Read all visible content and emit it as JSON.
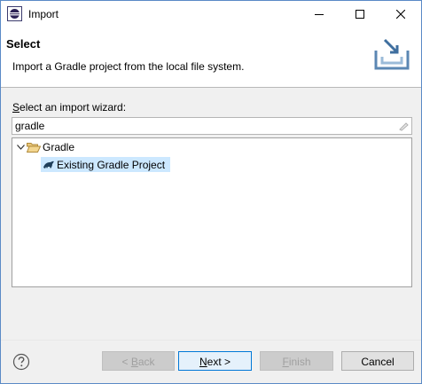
{
  "window": {
    "title": "Import"
  },
  "banner": {
    "title": "Select",
    "description": "Import a Gradle project from the local file system."
  },
  "wizard": {
    "label_mnemonic": "S",
    "label_rest": "elect an import wizard:",
    "filter_value": "gradle"
  },
  "tree": {
    "category": "Gradle",
    "item": "Existing Gradle Project"
  },
  "buttons": {
    "back_prefix": "< ",
    "back_mnemonic": "B",
    "back_rest": "ack",
    "next_mnemonic": "N",
    "next_rest": "ext >",
    "finish_mnemonic": "F",
    "finish_rest": "inish",
    "cancel": "Cancel"
  },
  "colors": {
    "selection": "#cce8ff",
    "default_button_border": "#0078d7",
    "window_border": "#5a8ac6"
  },
  "icons": [
    "eclipse-app-icon",
    "minimize-icon",
    "maximize-icon",
    "close-icon",
    "import-banner-icon",
    "clear-filter-icon",
    "expand-arrow-icon",
    "folder-open-icon",
    "gradle-elephant-icon",
    "help-icon"
  ]
}
